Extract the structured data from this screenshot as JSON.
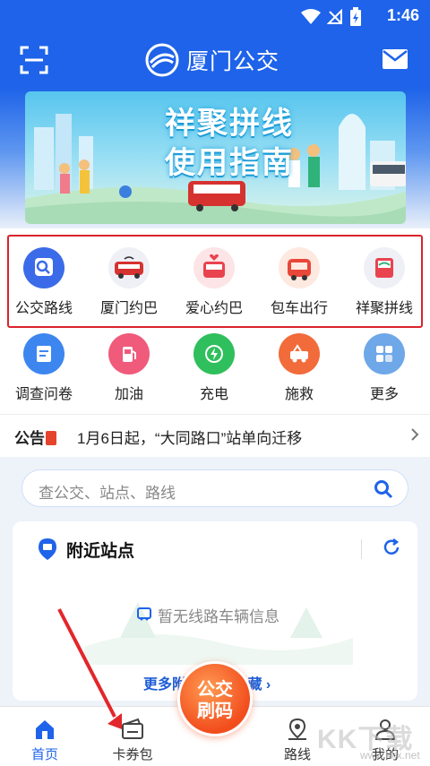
{
  "status_bar": {
    "time": "1:46"
  },
  "header": {
    "title": "厦门公交"
  },
  "banner": {
    "line1": "祥聚拼线",
    "line2": "使用指南"
  },
  "services_primary": [
    {
      "label": "公交路线",
      "icon": "bus-route-icon"
    },
    {
      "label": "厦门约巴",
      "icon": "minibus-icon"
    },
    {
      "label": "爱心约巴",
      "icon": "love-bus-icon"
    },
    {
      "label": "包车出行",
      "icon": "charter-bus-icon"
    },
    {
      "label": "祥聚拼线",
      "icon": "shared-line-icon"
    }
  ],
  "services_secondary": [
    {
      "label": "调查问卷",
      "icon": "survey-icon",
      "color": "#3d86f0"
    },
    {
      "label": "加油",
      "icon": "fuel-icon",
      "color": "#f05a7b"
    },
    {
      "label": "充电",
      "icon": "charge-icon",
      "color": "#2fbf5c"
    },
    {
      "label": "施救",
      "icon": "rescue-icon",
      "color": "#f26b3a"
    },
    {
      "label": "更多",
      "icon": "more-icon",
      "color": "#6fa8e8"
    }
  ],
  "notice": {
    "tag": "公告",
    "text": "1月6日起，“大同路口”站单向迁移"
  },
  "search": {
    "placeholder": "查公交、站点、路线"
  },
  "nearby": {
    "title": "附近站点",
    "empty_text": "暂无线路车辆信息",
    "more_label": "更多附近站点/收藏 ›"
  },
  "fab": {
    "line1": "公交",
    "line2": "刷码"
  },
  "tabs": [
    {
      "label": "首页",
      "icon": "home-icon",
      "active": true
    },
    {
      "label": "卡券包",
      "icon": "wallet-icon",
      "active": false
    },
    {
      "label": "路线",
      "icon": "route-icon",
      "active": false
    },
    {
      "label": "我的",
      "icon": "profile-icon",
      "active": false
    }
  ],
  "watermark": {
    "brand": "KK下载",
    "url": "www.kkx.net"
  },
  "colors": {
    "primary": "#1e63e9",
    "highlight": "#d9232b",
    "fab": "#f24d1d"
  }
}
